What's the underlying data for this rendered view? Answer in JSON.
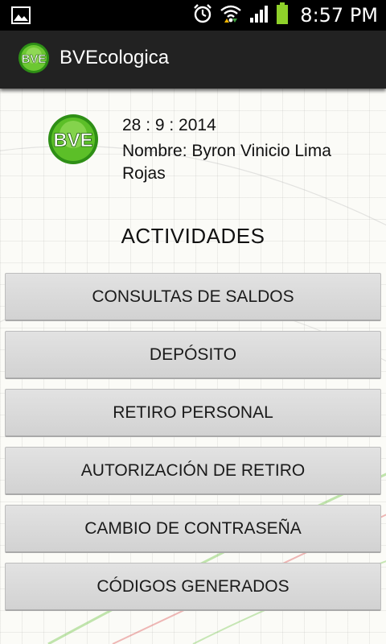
{
  "status_bar": {
    "time": "8:57 PM",
    "icons": [
      "image-notification-icon",
      "alarm-icon",
      "wifi-icon",
      "signal-icon",
      "battery-icon"
    ]
  },
  "action_bar": {
    "title": "BVEcologica",
    "logo_text": "BVE"
  },
  "profile": {
    "logo_text": "BVE",
    "date": "28 : 9 : 2014",
    "name": "Nombre: Byron Vinicio Lima Rojas"
  },
  "activities": {
    "title": "ACTIVIDADES",
    "buttons": [
      {
        "label": "CONSULTAS DE SALDOS"
      },
      {
        "label": "DEPÓSITO"
      },
      {
        "label": "RETIRO PERSONAL"
      },
      {
        "label": "AUTORIZACIÓN DE RETIRO"
      },
      {
        "label": "CAMBIO DE CONTRASEÑA"
      },
      {
        "label": "CÓDIGOS GENERADOS"
      }
    ]
  },
  "colors": {
    "logo_green": "#3fb020",
    "battery_green": "#8fd12a",
    "button_bg": "#d9d9d9",
    "action_bar_bg": "#222222"
  }
}
